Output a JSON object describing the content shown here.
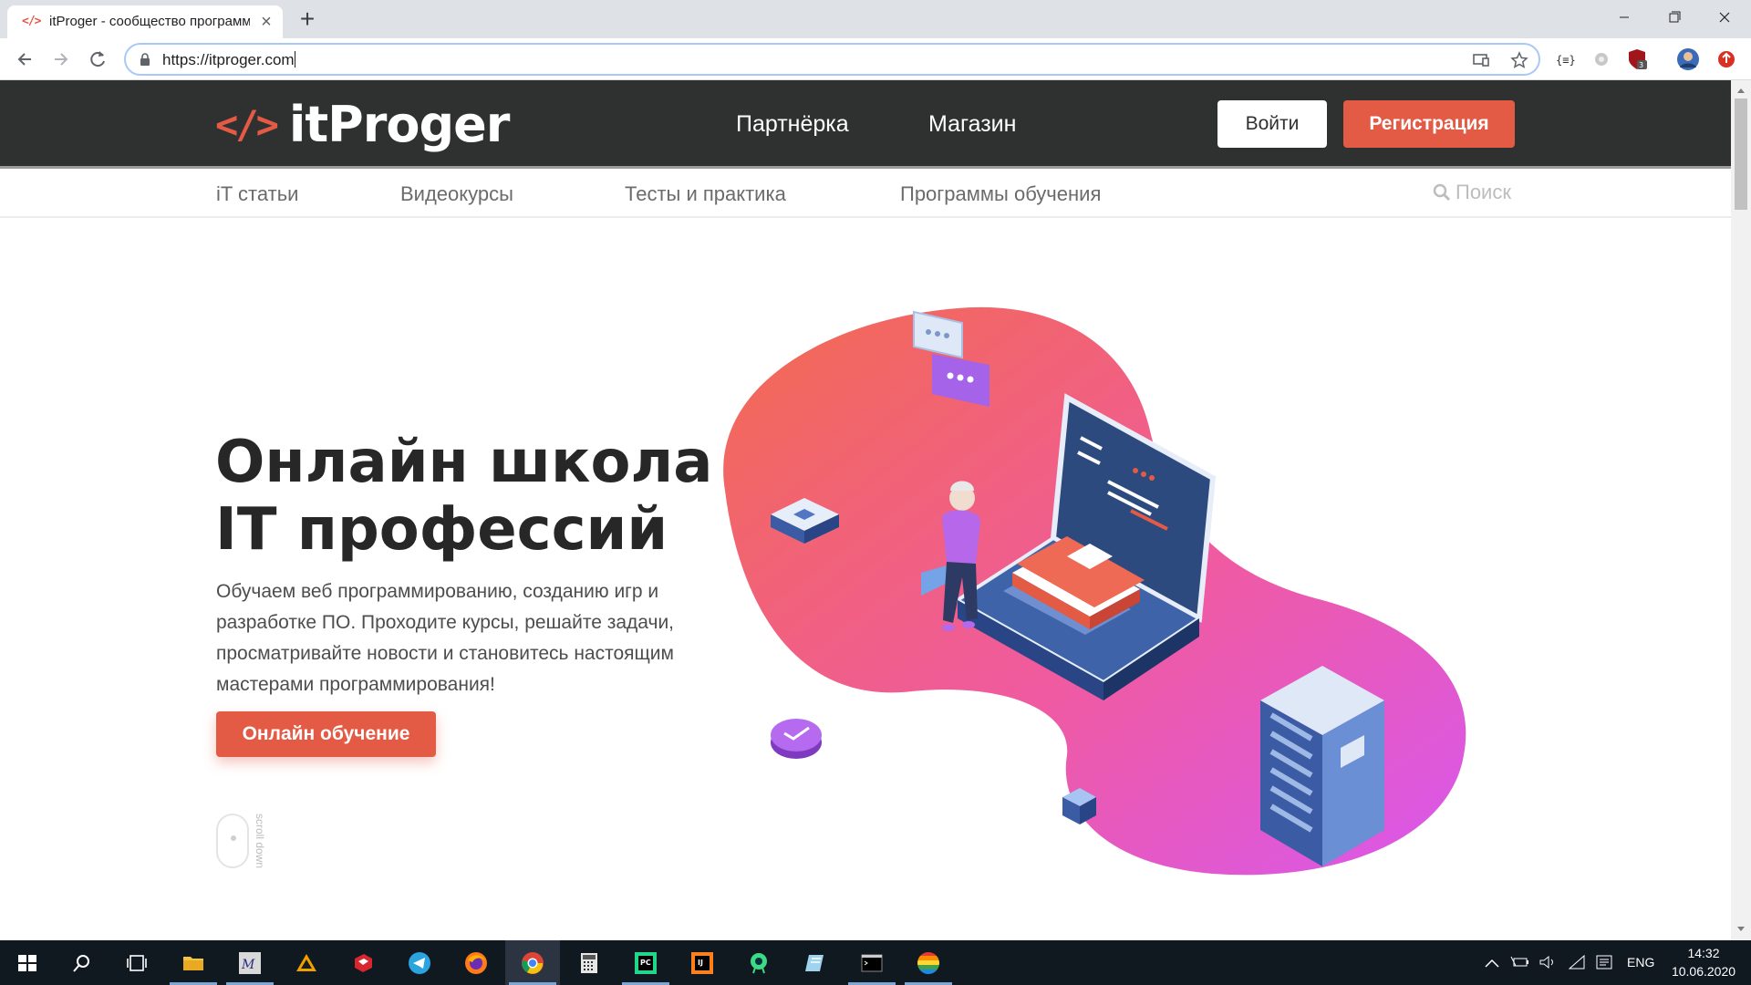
{
  "browser": {
    "tab_title": "itProger - сообщество программистов",
    "tab_favicon": "</>",
    "url": "https://itproger.com",
    "new_tab_symbol": "+"
  },
  "header": {
    "logo_mark": "</>",
    "logo_text": "itProger",
    "nav": [
      "Партнёрка",
      "Магазин"
    ],
    "login": "Войти",
    "register": "Регистрация"
  },
  "subnav": {
    "items": [
      "iT статьи",
      "Видеокурсы",
      "Тесты и практика",
      "Программы обучения"
    ],
    "search_placeholder": "Поиск"
  },
  "hero": {
    "title_line1": "Онлайн школа",
    "title_line2": "IT профессий",
    "text": "Обучаем веб программированию, созданию игр и разработке ПО. Проходите курсы, решайте задачи, просматривайте новости и становитесь настоящим мастерами программирования!",
    "cta": "Онлайн обучение",
    "scroll_label": "scroll down"
  },
  "taskbar": {
    "language": "ENG",
    "time": "14:32",
    "date": "10.06.2020"
  },
  "colors": {
    "accent": "#e35a45",
    "header_bg": "#2f3030",
    "blob_start": "#f26b4f",
    "blob_end": "#e359e8"
  }
}
